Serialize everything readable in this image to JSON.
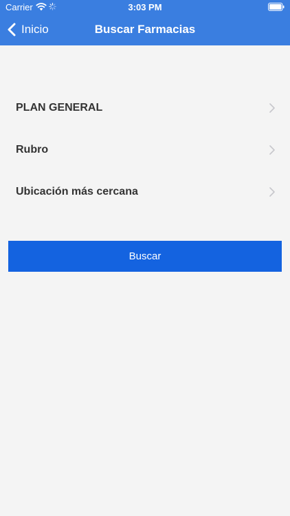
{
  "status_bar": {
    "carrier": "Carrier",
    "time": "3:03 PM"
  },
  "nav": {
    "back_label": "Inicio",
    "title": "Buscar Farmacias"
  },
  "menu": {
    "items": [
      {
        "label": "PLAN GENERAL",
        "icon": "chevron-right-icon"
      },
      {
        "label": "Rubro",
        "icon": "chevron-right-icon"
      },
      {
        "label": "Ubicación más cercana",
        "icon": "chevron-right-icon"
      }
    ]
  },
  "search_button": {
    "label": "Buscar"
  },
  "colors": {
    "header_background": "#3a7ee0",
    "button_background": "#1463e0",
    "page_background": "#f4f4f4",
    "label_text": "#333333",
    "chevron": "#c7c7cc"
  }
}
